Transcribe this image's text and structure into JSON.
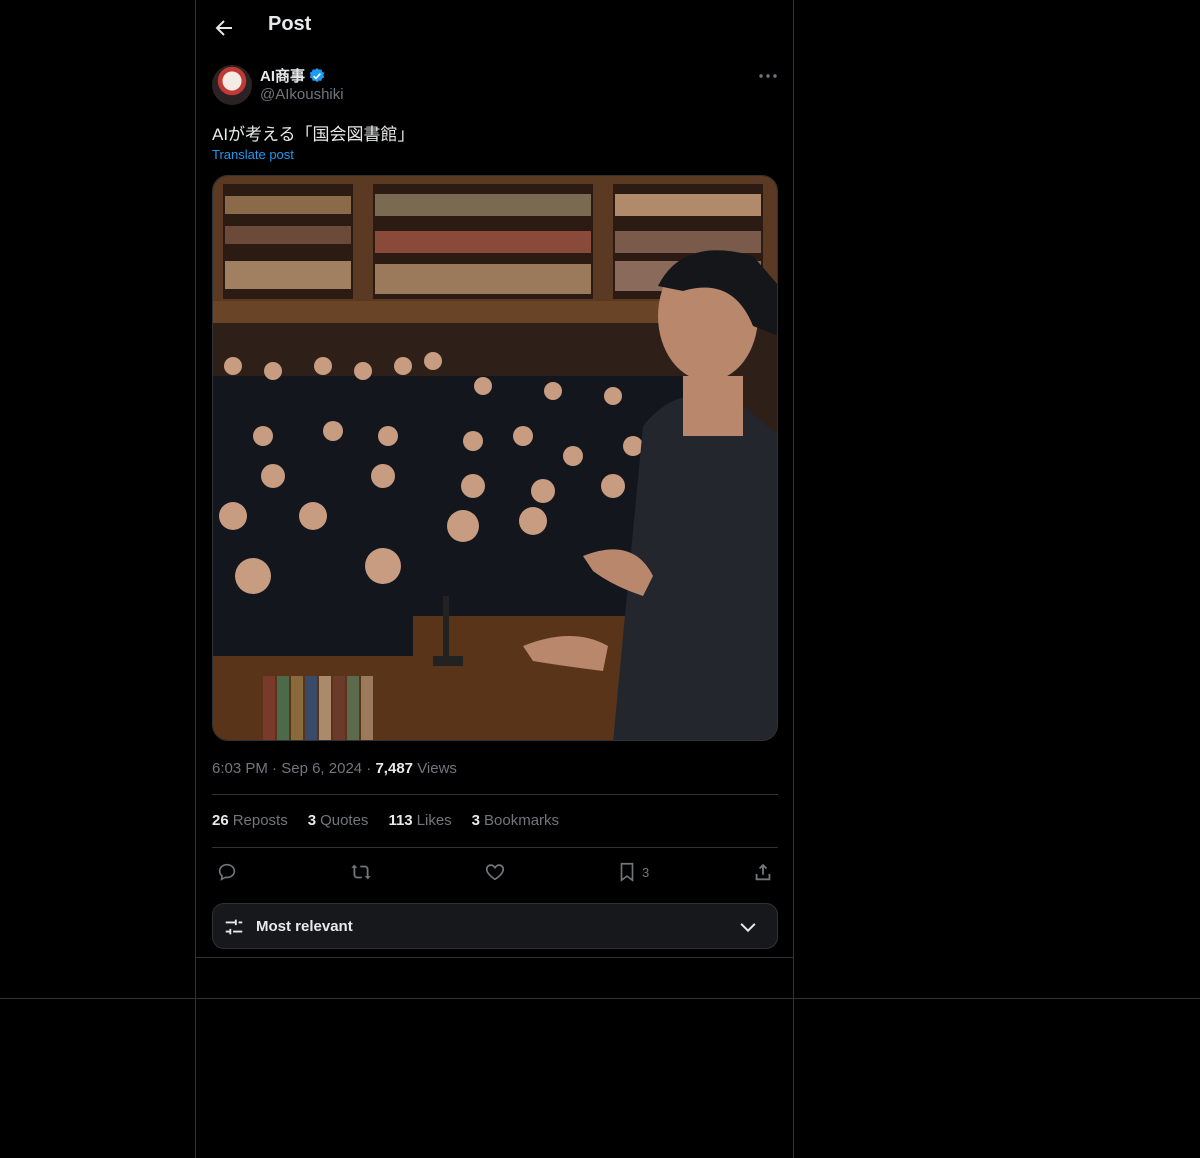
{
  "header": {
    "title": "Post"
  },
  "author": {
    "name": "AI商事",
    "handle": "@AIkoushiki"
  },
  "post": {
    "text": "AIが考える「国会図書館」",
    "translate_label": "Translate post",
    "time": "6:03 PM",
    "date": "Sep 6, 2024",
    "views_count": "7,487",
    "views_label": "Views"
  },
  "stats": [
    {
      "count": "26",
      "label": "Reposts"
    },
    {
      "count": "3",
      "label": "Quotes"
    },
    {
      "count": "113",
      "label": "Likes"
    },
    {
      "count": "3",
      "label": "Bookmarks"
    }
  ],
  "actions": {
    "bookmark_count": "3"
  },
  "sort": {
    "label": "Most relevant"
  },
  "colors": {
    "accent": "#1d9bf0",
    "background": "#000000",
    "border": "#2f3336",
    "muted": "#71767b"
  },
  "icons": [
    "back-arrow-icon",
    "verified-badge-icon",
    "more-icon",
    "reply-icon",
    "repost-icon",
    "like-icon",
    "bookmark-icon",
    "share-icon",
    "sliders-icon",
    "chevron-down-icon"
  ]
}
